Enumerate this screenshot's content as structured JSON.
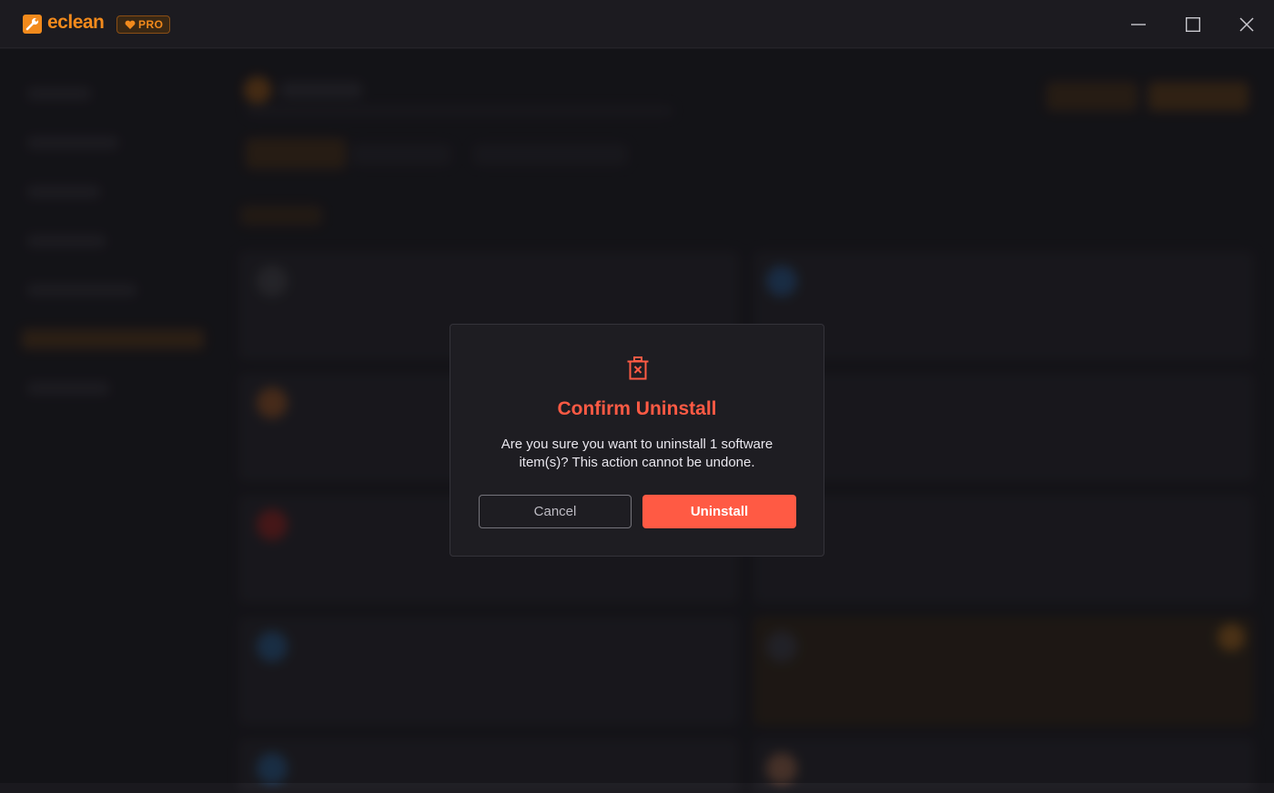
{
  "app": {
    "name": "eclean",
    "badge": "PRO",
    "accent_color": "#f28a1c"
  },
  "window_controls": {
    "minimize": "minimize-icon",
    "maximize": "maximize-icon",
    "close": "close-icon"
  },
  "dialog": {
    "icon": "trash-x-icon",
    "title": "Confirm Uninstall",
    "message": "Are you sure you want to uninstall 1 software item(s)? This action cannot be undone.",
    "cancel_label": "Cancel",
    "confirm_label": "Uninstall",
    "danger_color": "#ff5a44"
  }
}
